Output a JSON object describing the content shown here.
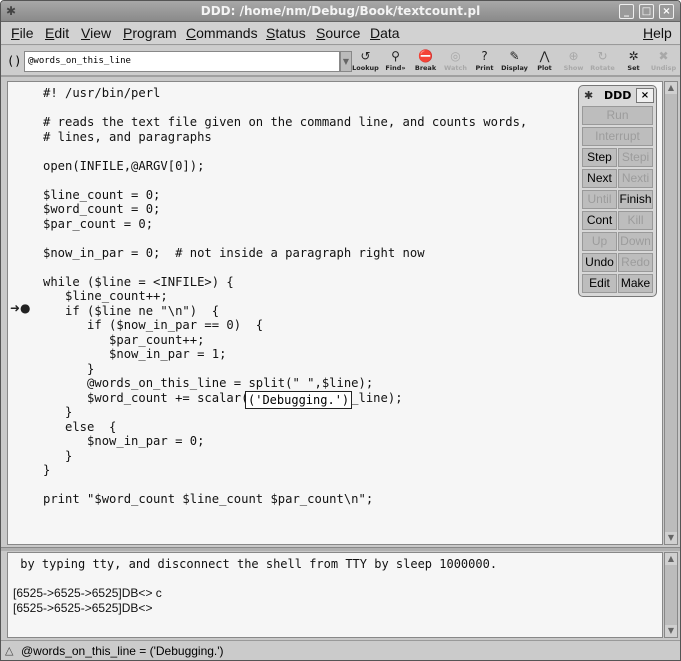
{
  "window": {
    "title": "DDD: /home/nm/Debug/Book/textcount.pl",
    "controls": [
      "_",
      "□",
      "×"
    ]
  },
  "menubar": {
    "items": [
      "File",
      "Edit",
      "View",
      "Program",
      "Commands",
      "Status",
      "Source",
      "Data"
    ],
    "help": "Help"
  },
  "toolbar": {
    "arg_label": "():",
    "arg_value": "@words_on_this_line",
    "tools": [
      {
        "label": "Lookup",
        "icon": "↺",
        "enabled": true
      },
      {
        "label": "Find»",
        "icon": "⚲",
        "enabled": true
      },
      {
        "label": "Break",
        "icon": "⛔",
        "enabled": true
      },
      {
        "label": "Watch",
        "icon": "◎",
        "enabled": false
      },
      {
        "label": "Print",
        "icon": "?",
        "enabled": true
      },
      {
        "label": "Display",
        "icon": "✎",
        "enabled": true
      },
      {
        "label": "Plot",
        "icon": "⋀",
        "enabled": true
      },
      {
        "label": "Show",
        "icon": "⊕",
        "enabled": false
      },
      {
        "label": "Rotate",
        "icon": "↻",
        "enabled": false
      },
      {
        "label": "Set",
        "icon": "✲",
        "enabled": true
      },
      {
        "label": "Undisp",
        "icon": "✖",
        "enabled": false
      }
    ]
  },
  "source": {
    "lines": [
      "#! /usr/bin/perl",
      "",
      "# reads the text file given on the command line, and counts words,",
      "# lines, and paragraphs",
      "",
      "open(INFILE,@ARGV[0]);",
      "",
      "$line_count = 0;",
      "$word_count = 0;",
      "$par_count = 0;",
      "",
      "$now_in_par = 0;  # not inside a paragraph right now",
      "",
      "while ($line = <INFILE>) {",
      "   $line_count++;",
      "   if ($line ne \"\\n\")  {",
      "      if ($now_in_par == 0)  {",
      "         $par_count++;",
      "         $now_in_par = 1;",
      "      }",
      "      @words_on_this_line = split(\" \",$line);",
      "      $word_count += scalar(@words_on_this_line);",
      "   }",
      "   else  {",
      "      $now_in_par = 0;",
      "   }",
      "}",
      "",
      "print \"$word_count $line_count $par_count\\n\";"
    ],
    "current_line": 16,
    "tooltip": "('Debugging.')"
  },
  "console": {
    "lines": [
      " by typing tty, and disconnect the shell from TTY by sleep 1000000.",
      "",
      "[6525->6525->6525]DB<> c",
      "[6525->6525->6525]DB<>"
    ]
  },
  "status": {
    "message": "@words_on_this_line = ('Debugging.')"
  },
  "command_tool": {
    "title": "DDD",
    "close": "×",
    "buttons": [
      {
        "label": "Run",
        "enabled": false
      },
      {
        "label": "Interrupt",
        "enabled": false
      },
      {
        "label": "Step",
        "enabled": true
      },
      {
        "label": "Stepi",
        "enabled": false
      },
      {
        "label": "Next",
        "enabled": true
      },
      {
        "label": "Nexti",
        "enabled": false
      },
      {
        "label": "Until",
        "enabled": false
      },
      {
        "label": "Finish",
        "enabled": true
      },
      {
        "label": "Cont",
        "enabled": true
      },
      {
        "label": "Kill",
        "enabled": false
      },
      {
        "label": "Up",
        "enabled": false
      },
      {
        "label": "Down",
        "enabled": false
      },
      {
        "label": "Undo",
        "enabled": true
      },
      {
        "label": "Redo",
        "enabled": false
      },
      {
        "label": "Edit",
        "enabled": true
      },
      {
        "label": "Make",
        "enabled": true
      }
    ]
  }
}
